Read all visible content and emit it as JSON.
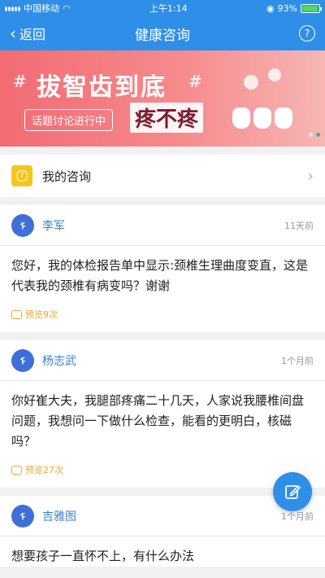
{
  "status": {
    "carrier": "中国移动",
    "time": "上午1:14",
    "battery": "93%"
  },
  "nav": {
    "back_label": "返回",
    "title": "健康咨询",
    "help_symbol": "?"
  },
  "banner": {
    "title": "拔智齿到底",
    "tag": "话题讨论进行中",
    "subtitle": "疼不疼"
  },
  "my_consult": {
    "label": "我的咨询"
  },
  "posts": [
    {
      "name": "李军",
      "time": "11天前",
      "text": "您好，我的体检报告单中显示:颈椎生理曲度变直，这是代表我的颈椎有病变吗？谢谢",
      "views": "预览9次"
    },
    {
      "name": "杨志武",
      "time": "1个月前",
      "text": "你好崔大夫，我腿部疼痛二十几天，人家说我腰椎间盘问题，我想问一下做什么检查，能看的更明白，核磁吗？",
      "views": "预览27次"
    },
    {
      "name": "吉雅图",
      "time": "1个月前",
      "text": "想要孩子一直怀不上，有什么办法"
    }
  ],
  "colors": {
    "brand": "#2f8fe8",
    "accent": "#f2a81e",
    "link": "#3a7fd3"
  }
}
